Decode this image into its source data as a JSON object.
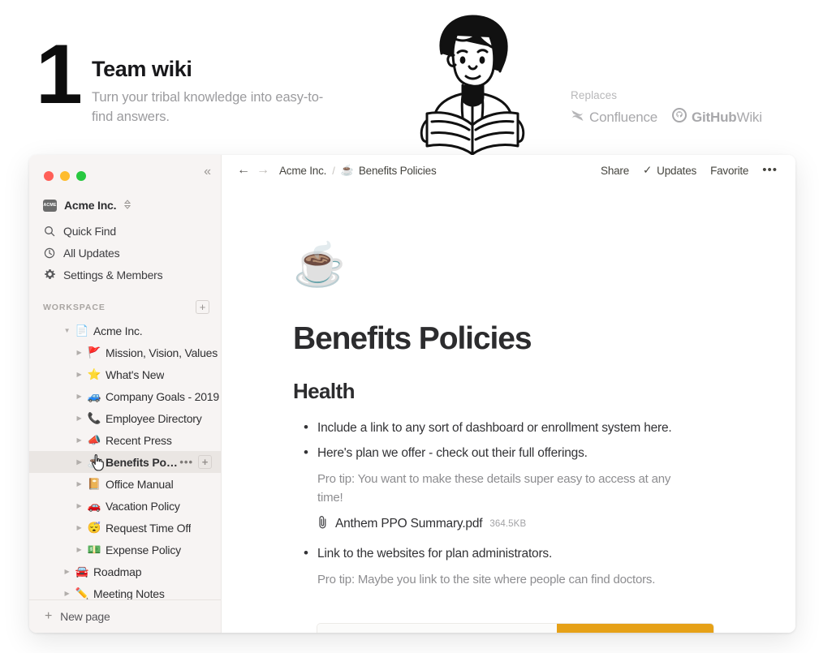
{
  "hero": {
    "number": "1",
    "title": "Team wiki",
    "subtitle": "Turn your tribal knowledge into easy-to-find answers.",
    "illustration_name": "person-reading-book-illustration",
    "replaces": {
      "label": "Replaces",
      "items": [
        {
          "name": "Confluence",
          "icon": "confluence-icon",
          "bold_part": "",
          "rest": "Confluence"
        },
        {
          "name": "GitHub Wiki",
          "icon": "github-icon",
          "bold_part": "GitHub",
          "rest": "Wiki"
        }
      ]
    }
  },
  "window": {
    "traffic_lights": [
      "close",
      "minimize",
      "zoom"
    ],
    "collapse_icon": "«"
  },
  "sidebar": {
    "workspace": {
      "badge_text": "ACME",
      "name": "Acme Inc.",
      "caret": "⌃⌄"
    },
    "nav": [
      {
        "label": "Quick Find",
        "icon": "search-icon"
      },
      {
        "label": "All Updates",
        "icon": "clock-icon"
      },
      {
        "label": "Settings & Members",
        "icon": "gear-icon"
      }
    ],
    "section": {
      "title": "WORKSPACE",
      "add_label": "+"
    },
    "tree": [
      {
        "label": "Acme Inc.",
        "emoji": "📄",
        "indent": 0,
        "caret": "▼",
        "selected": false
      },
      {
        "label": "Mission, Vision, Values",
        "emoji": "🚩",
        "indent": 1,
        "caret": "▶",
        "selected": false
      },
      {
        "label": "What's New",
        "emoji": "⭐",
        "indent": 1,
        "caret": "▶",
        "selected": false
      },
      {
        "label": "Company Goals - 2019",
        "emoji": "🚙",
        "indent": 1,
        "caret": "▶",
        "selected": false
      },
      {
        "label": "Employee Directory",
        "emoji": "📞",
        "indent": 1,
        "caret": "▶",
        "selected": false
      },
      {
        "label": "Recent Press",
        "emoji": "📣",
        "indent": 1,
        "caret": "▶",
        "selected": false
      },
      {
        "label": "Benefits Polici...",
        "emoji": "☕",
        "indent": 1,
        "caret": "▶",
        "selected": true,
        "actions": [
          "•••",
          "+"
        ]
      },
      {
        "label": "Office Manual",
        "emoji": "📔",
        "indent": 1,
        "caret": "▶",
        "selected": false
      },
      {
        "label": "Vacation Policy",
        "emoji": "🚗",
        "indent": 1,
        "caret": "▶",
        "selected": false
      },
      {
        "label": "Request Time Off",
        "emoji": "😴",
        "indent": 1,
        "caret": "▶",
        "selected": false
      },
      {
        "label": "Expense Policy",
        "emoji": "💵",
        "indent": 1,
        "caret": "▶",
        "selected": false
      },
      {
        "label": "Roadmap",
        "emoji": "🚘",
        "indent": 0,
        "caret": "▶",
        "selected": false
      },
      {
        "label": "Meeting Notes",
        "emoji": "✏️",
        "indent": 0,
        "caret": "▶",
        "selected": false
      }
    ],
    "footer": {
      "new_page_label": "New page",
      "plus": "+"
    }
  },
  "topbar": {
    "back": "←",
    "forward": "→",
    "breadcrumb_root": "Acme Inc.",
    "breadcrumb_sep": "/",
    "breadcrumb_emoji": "☕",
    "breadcrumb_current": "Benefits Policies",
    "share_label": "Share",
    "updates_label": "Updates",
    "updates_check": "✓",
    "favorite_label": "Favorite",
    "more_label": "•••"
  },
  "document": {
    "emoji": "☕",
    "title": "Benefits Policies",
    "heading": "Health",
    "bullets": [
      "Include a link to any sort of dashboard or enrollment system here.",
      "Here's plan we offer - check out their full offerings."
    ],
    "pro_tip_1": "Pro tip: You want to make these details super easy to access at any time!",
    "attachment": {
      "name": "Anthem PPO Summary.pdf",
      "size": "364.5KB",
      "icon": "paperclip-icon"
    },
    "bullet_3": "Link to the websites for plan administrators.",
    "pro_tip_2": "Pro tip: Maybe you link to the site where people can find doctors."
  },
  "colors": {
    "sidebar_bg": "#f7f4f3",
    "selected_row": "#eae6e3",
    "accent_orange": "#e6a117",
    "text_primary": "#2c2c2e",
    "text_muted": "#8d8d90"
  }
}
